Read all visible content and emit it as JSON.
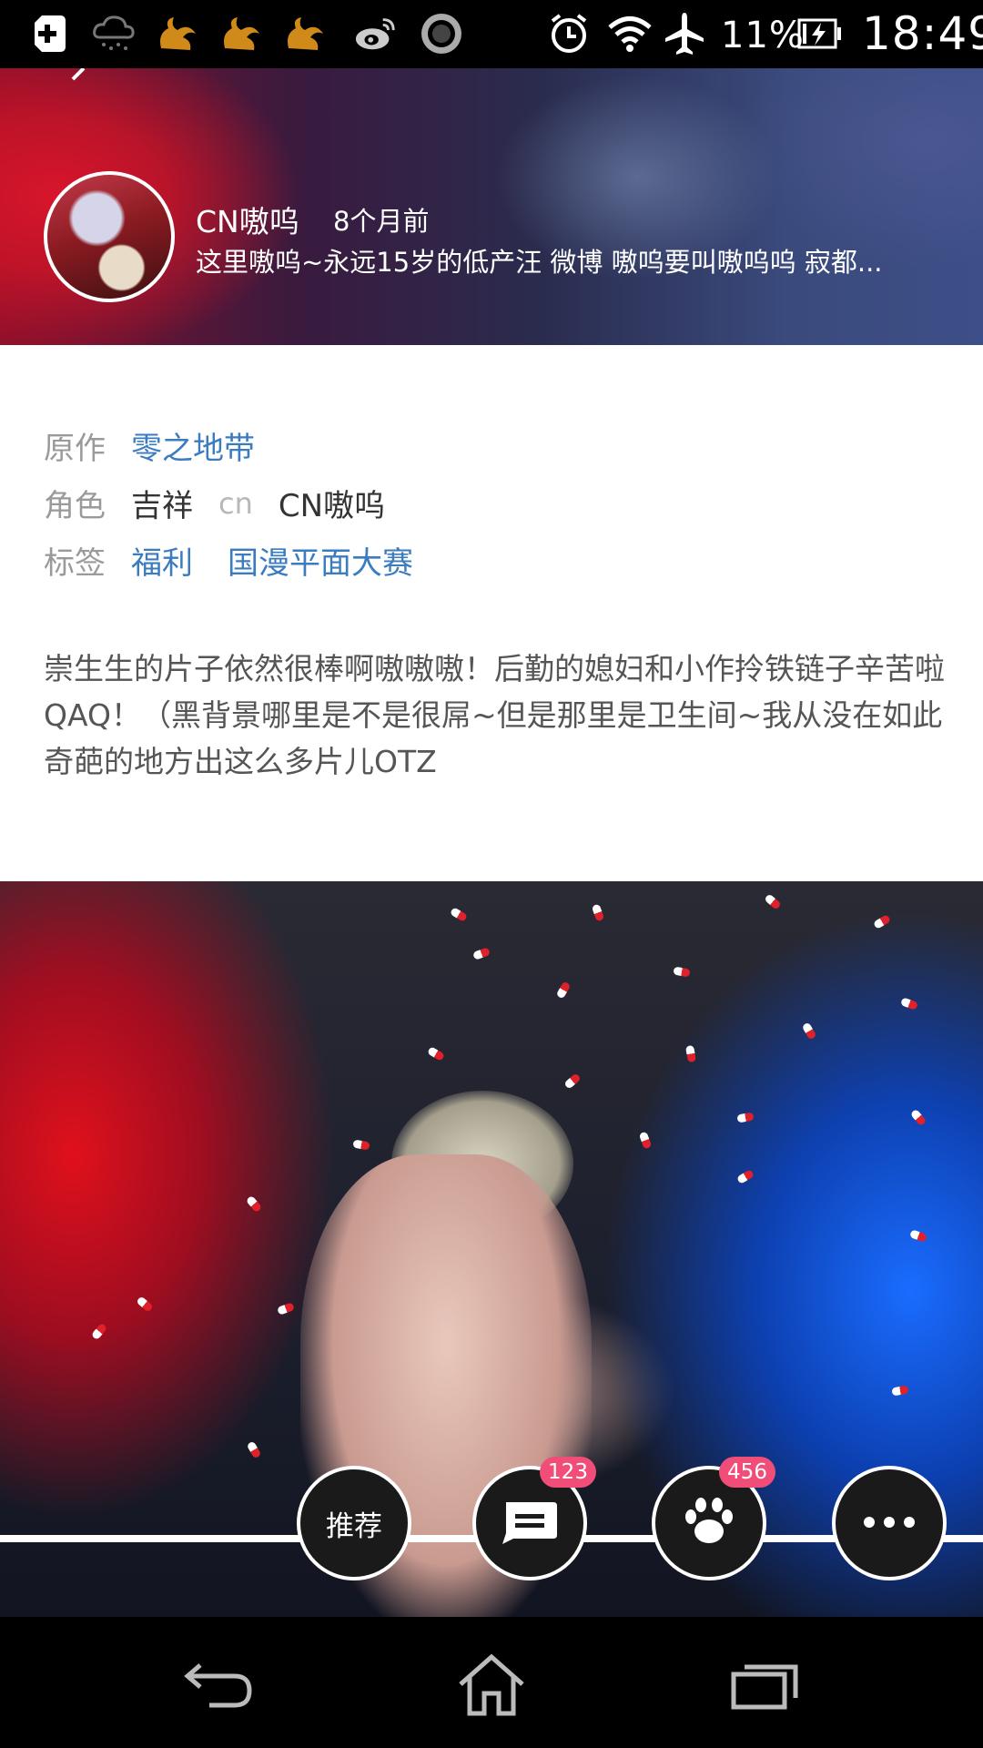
{
  "status_bar": {
    "left_icons": [
      "plus-icon",
      "rain-cloud-icon",
      "uc-browser-icon",
      "uc-browser-icon",
      "uc-browser-icon",
      "weibo-icon",
      "record-icon"
    ],
    "right_icons": [
      "alarm-icon",
      "wifi-icon",
      "airplane-icon"
    ],
    "battery_percent": "11%",
    "time": "18:49"
  },
  "author": {
    "name": "CN嗷呜",
    "time_ago": "8个月前",
    "bio": "这里嗷呜~永远15岁的低产汪 微博 嗷呜要叫嗷呜呜 寂都..."
  },
  "meta": {
    "original_label": "原作",
    "original_value": "零之地带",
    "role_label": "角色",
    "role_character": "吉祥",
    "role_separator": "cn",
    "role_cosplayer": "CN嗷呜",
    "tags_label": "标签",
    "tags": [
      "福利",
      "国漫平面大赛"
    ]
  },
  "description": "崇生生的片子依然很棒啊嗷嗷嗷！后勤的媳妇和小作拎铁链子辛苦啦QAQ！（黑背景哪里是不是很屌~但是那里是卫生间~我从没在如此奇葩的地方出这么多片儿OTZ",
  "actions": {
    "recommend_label": "推荐",
    "comments_count": "123",
    "likes_count": "456"
  },
  "colors": {
    "link": "#3a7cbf",
    "badge": "#f04e78"
  }
}
